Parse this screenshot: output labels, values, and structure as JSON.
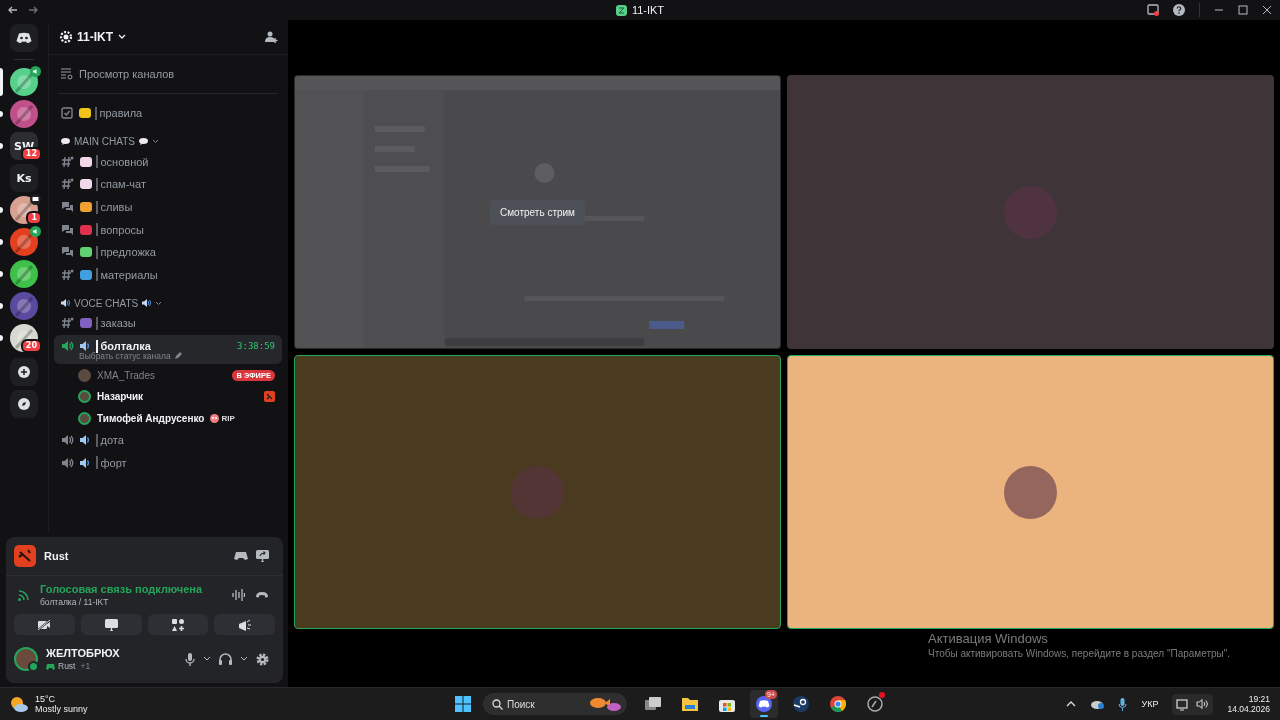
{
  "titlebar": {
    "title": "11-IKT"
  },
  "servers": [
    {
      "kind": "app",
      "color": "#57d08c",
      "selected": true,
      "unread": false,
      "voice": true,
      "screen": false
    },
    {
      "kind": "app",
      "color": "#c0508a",
      "selected": false,
      "unread": true,
      "voice": false,
      "screen": false
    },
    {
      "kind": "letters",
      "text": "SW",
      "color": "#2b2d31",
      "selected": false,
      "unread": true,
      "badge": "12",
      "voice": false,
      "screen": false
    },
    {
      "kind": "letters",
      "text": "Ks",
      "color": "#1e1f22",
      "selected": false,
      "unread": false,
      "voice": false,
      "screen": false
    },
    {
      "kind": "app",
      "color": "#d8a090",
      "selected": false,
      "unread": true,
      "badge": "1",
      "voice": false,
      "screen": true
    },
    {
      "kind": "app",
      "color": "#e2401e",
      "selected": false,
      "unread": true,
      "voice": true,
      "screen": false
    },
    {
      "kind": "app",
      "color": "#3fc04a",
      "selected": false,
      "unread": true,
      "voice": false,
      "screen": false
    },
    {
      "kind": "app",
      "color": "#5a4aa0",
      "selected": false,
      "unread": true,
      "voice": false,
      "screen": false
    },
    {
      "kind": "app",
      "color": "#d8d8d0",
      "selected": false,
      "unread": true,
      "badge": "20",
      "voice": false,
      "screen": false
    }
  ],
  "server": {
    "name": "11-IKT",
    "browse": "Просмотр каналов"
  },
  "channels": [
    {
      "kind": "rules",
      "color": "#f0c419",
      "name": "правила",
      "selected": false
    },
    {
      "kind": "category",
      "name": "MAIN CHATS",
      "expanded": true
    },
    {
      "kind": "text",
      "color": "#f0d8e8",
      "name": "основной",
      "selected": false
    },
    {
      "kind": "text",
      "color": "#f0d8e8",
      "name": "спам-чат",
      "selected": false
    },
    {
      "kind": "forum",
      "color": "#f0a030",
      "name": "сливы",
      "selected": false
    },
    {
      "kind": "forum",
      "color": "#e03050",
      "name": "вопросы",
      "selected": false
    },
    {
      "kind": "forum",
      "color": "#60d070",
      "name": "предложка",
      "selected": false
    },
    {
      "kind": "text",
      "color": "#40a0e0",
      "name": "материалы",
      "selected": false
    },
    {
      "kind": "category",
      "name": "VOCE CHATS",
      "expanded": true
    },
    {
      "kind": "text",
      "color": "#8060c0",
      "name": "заказы",
      "selected": false
    },
    {
      "kind": "voice",
      "color": "#a0c8f0",
      "name": "болталка",
      "selected": true,
      "timer": "3:38:59",
      "status": "Выбрать статус канала",
      "members": [
        {
          "name": "XMA_Trades",
          "dimmed": true,
          "speaking": false,
          "live": "В ЭФИРЕ",
          "playing": false
        },
        {
          "name": "Назарчик",
          "dimmed": false,
          "speaking": true,
          "playing": true
        },
        {
          "name": "Тимофей Андрусенко",
          "dimmed": false,
          "speaking": true,
          "playing": false,
          "tag": "RIP"
        }
      ]
    },
    {
      "kind": "voice",
      "color": "#a0c8f0",
      "name": "дота",
      "selected": false
    },
    {
      "kind": "voice",
      "color": "#a0c8f0",
      "name": "форт",
      "selected": false
    }
  ],
  "panel": {
    "activity": "Rust",
    "connection": {
      "status": "Голосовая связь подключена",
      "channel": "болталка / 11-IKT"
    },
    "user": {
      "name": "ЖЕЛТОБРЮХ",
      "game": "Rust",
      "extra": "+1",
      "online": true
    }
  },
  "tiles": [
    {
      "kind": "stream",
      "button": "Смотреть стрим",
      "speaking": false
    },
    {
      "kind": "avatar",
      "color": "#3f3539",
      "speaking": false
    },
    {
      "kind": "avatar",
      "color": "#4a3a1f",
      "speaking": true
    },
    {
      "kind": "avatar",
      "color": "#ebb47f",
      "speaking": true
    }
  ],
  "activation": {
    "title": "Активация Windows",
    "text": "Чтобы активировать Windows, перейдите в раздел \"Параметры\"."
  },
  "taskbar": {
    "weather": {
      "temp": "15°C",
      "text": "Mostly sunny"
    },
    "search": {
      "placeholder": "Поиск"
    },
    "apps": [
      {
        "kind": "taskview",
        "active": false,
        "alert": false
      },
      {
        "kind": "files",
        "active": false,
        "alert": false
      },
      {
        "kind": "store",
        "active": false,
        "alert": false
      },
      {
        "kind": "discord",
        "active": true,
        "alert": false,
        "badge": "9+"
      },
      {
        "kind": "steam",
        "active": false,
        "alert": false
      },
      {
        "kind": "chrome",
        "active": false,
        "alert": false
      },
      {
        "kind": "other",
        "active": false,
        "alert": true
      }
    ],
    "language": "УКР",
    "time": "19:21",
    "date": "14.04.2026"
  }
}
